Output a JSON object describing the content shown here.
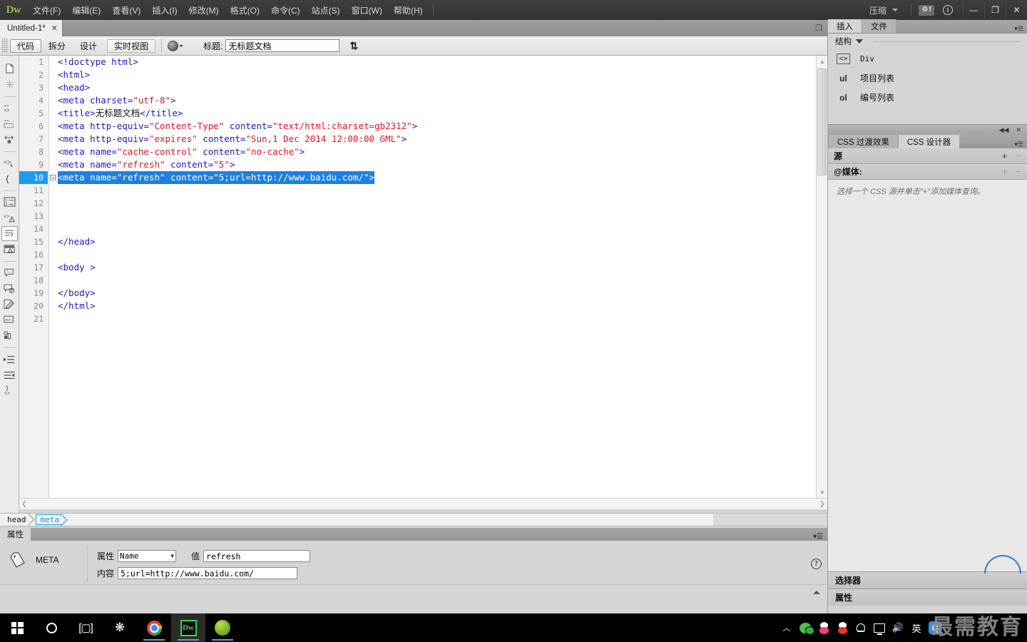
{
  "app": {
    "logo": "Dw",
    "menus": [
      {
        "label": "文件(F)"
      },
      {
        "label": "编辑(E)"
      },
      {
        "label": "查看(V)"
      },
      {
        "label": "插入(I)"
      },
      {
        "label": "修改(M)"
      },
      {
        "label": "格式(O)"
      },
      {
        "label": "命令(C)"
      },
      {
        "label": "站点(S)"
      },
      {
        "label": "窗口(W)"
      },
      {
        "label": "帮助(H)"
      }
    ],
    "workspace_label": "压缩",
    "window_controls": {
      "minimize": "—",
      "restore": "❐",
      "close": "✕"
    }
  },
  "document_tab": {
    "title": "Untitled-1*",
    "close": "✕"
  },
  "view_toolbar": {
    "buttons": [
      {
        "label": "代码",
        "active": true
      },
      {
        "label": "拆分",
        "active": false
      },
      {
        "label": "设计",
        "active": false
      }
    ],
    "live_view_label": "实时视图",
    "title_label": "标题:",
    "title_value": "无标题文档",
    "file_management_icon": "updown-arrows-icon"
  },
  "editor": {
    "lines": [
      {
        "num": "1",
        "indent": 0,
        "selected": false,
        "fold": false,
        "tokens": [
          {
            "t": "&lt;!doctype html&gt;",
            "c": "k-plain"
          }
        ]
      },
      {
        "num": "2",
        "indent": 0,
        "selected": false,
        "fold": false,
        "tokens": [
          {
            "t": "&lt;html&gt;",
            "c": "k-plain"
          }
        ]
      },
      {
        "num": "3",
        "indent": 0,
        "selected": false,
        "fold": false,
        "tokens": [
          {
            "t": "&lt;head&gt;",
            "c": "k-plain"
          }
        ]
      },
      {
        "num": "4",
        "indent": 0,
        "selected": false,
        "fold": false,
        "tokens": [
          {
            "t": "&lt;meta charset=",
            "c": "k-plain"
          },
          {
            "t": "\"utf-8\"",
            "c": "k-str"
          },
          {
            "t": "&gt;",
            "c": "k-plain"
          }
        ]
      },
      {
        "num": "5",
        "indent": 0,
        "selected": false,
        "fold": false,
        "tokens": [
          {
            "t": "&lt;title&gt;",
            "c": "k-plain"
          },
          {
            "t": "无标题文档",
            "c": "k-cjk"
          },
          {
            "t": "&lt;/title&gt;",
            "c": "k-plain"
          }
        ]
      },
      {
        "num": "6",
        "indent": 0,
        "selected": false,
        "fold": false,
        "tokens": [
          {
            "t": "&lt;meta http-equiv=",
            "c": "k-plain"
          },
          {
            "t": "\"Content-Type\"",
            "c": "k-str"
          },
          {
            "t": " content=",
            "c": "k-plain"
          },
          {
            "t": "\"text/html:charset=gb2312\"",
            "c": "k-str"
          },
          {
            "t": "&gt;",
            "c": "k-plain"
          }
        ]
      },
      {
        "num": "7",
        "indent": 0,
        "selected": false,
        "fold": false,
        "tokens": [
          {
            "t": "&lt;meta http-equiv=",
            "c": "k-plain"
          },
          {
            "t": "\"expires\"",
            "c": "k-str"
          },
          {
            "t": " content=",
            "c": "k-plain"
          },
          {
            "t": "\"Sun,1 Dec 2014 12:00:00 GML\"",
            "c": "k-str"
          },
          {
            "t": "&gt;",
            "c": "k-plain"
          }
        ]
      },
      {
        "num": "8",
        "indent": 0,
        "selected": false,
        "fold": false,
        "tokens": [
          {
            "t": "&lt;meta name=",
            "c": "k-plain"
          },
          {
            "t": "\"cache-control\"",
            "c": "k-str"
          },
          {
            "t": " content=",
            "c": "k-plain"
          },
          {
            "t": "\"no-cache\"",
            "c": "k-str"
          },
          {
            "t": "&gt;",
            "c": "k-plain"
          }
        ]
      },
      {
        "num": "9",
        "indent": 0,
        "selected": false,
        "fold": false,
        "tokens": [
          {
            "t": "&lt;meta name=",
            "c": "k-plain"
          },
          {
            "t": "\"refresh\"",
            "c": "k-str"
          },
          {
            "t": " content=",
            "c": "k-plain"
          },
          {
            "t": "\"5\"",
            "c": "k-str"
          },
          {
            "t": "&gt;",
            "c": "k-plain"
          }
        ]
      },
      {
        "num": "10",
        "indent": 0,
        "selected": true,
        "fold": true,
        "tokens": [
          {
            "t": "&lt;meta name=\"refresh\" content=\"5;url=http://www.baidu.com/\"&gt;",
            "c": ""
          }
        ]
      },
      {
        "num": "11",
        "indent": 0,
        "selected": false,
        "fold": false,
        "tokens": []
      },
      {
        "num": "12",
        "indent": 0,
        "selected": false,
        "fold": false,
        "tokens": []
      },
      {
        "num": "13",
        "indent": 0,
        "selected": false,
        "fold": false,
        "tokens": []
      },
      {
        "num": "14",
        "indent": 0,
        "selected": false,
        "fold": false,
        "tokens": []
      },
      {
        "num": "15",
        "indent": 0,
        "selected": false,
        "fold": false,
        "tokens": [
          {
            "t": "&lt;/head&gt;",
            "c": "k-plain"
          }
        ]
      },
      {
        "num": "16",
        "indent": 0,
        "selected": false,
        "fold": false,
        "tokens": []
      },
      {
        "num": "17",
        "indent": 0,
        "selected": false,
        "fold": false,
        "tokens": [
          {
            "t": "&lt;body &gt;",
            "c": "k-plain"
          }
        ]
      },
      {
        "num": "18",
        "indent": 0,
        "selected": false,
        "fold": false,
        "tokens": []
      },
      {
        "num": "19",
        "indent": 0,
        "selected": false,
        "fold": false,
        "tokens": [
          {
            "t": "&lt;/body&gt;",
            "c": "k-plain"
          }
        ]
      },
      {
        "num": "20",
        "indent": 0,
        "selected": false,
        "fold": false,
        "tokens": [
          {
            "t": "&lt;/html&gt;",
            "c": "k-plain"
          }
        ]
      },
      {
        "num": "21",
        "indent": 0,
        "selected": false,
        "fold": false,
        "tokens": []
      }
    ],
    "selection_bg": "#1e7fe0",
    "tag_color": "#1a1ac0",
    "string_color": "#e2152a"
  },
  "tag_selector": {
    "chips": [
      {
        "label": "head",
        "active": false
      },
      {
        "label": "meta",
        "active": true
      }
    ]
  },
  "properties": {
    "tab_label": "属性",
    "element_type": "META",
    "attribute_label": "属性",
    "attribute_value": "Name",
    "value_label": "值",
    "value_value": "refresh",
    "content_label": "内容",
    "content_value": "5;url=http://www.baidu.com/",
    "help_icon": "question-mark-icon"
  },
  "dock": {
    "tabs": [
      {
        "label": "插入",
        "active": true
      },
      {
        "label": "文件",
        "active": false
      }
    ],
    "insert_panel": {
      "category": "结构",
      "items": [
        {
          "icon": "code-brackets-icon",
          "icon_text": "<>",
          "label": "Div",
          "mono": true
        },
        {
          "icon": "ul-icon",
          "icon_text": "ul",
          "label": "项目列表",
          "mono": false
        },
        {
          "icon": "ol-icon",
          "icon_text": "ol",
          "label": "编号列表",
          "mono": false
        }
      ]
    },
    "css_tabs": [
      {
        "label": "CSS 过渡效果",
        "active": false
      },
      {
        "label": "CSS 设计器",
        "active": true
      }
    ],
    "css_designer": {
      "sources_label": "源",
      "media_label": "@媒体:",
      "hint": "选择一个 CSS 源并单击\"+\"添加媒体查询。",
      "selector_label": "选择器",
      "properties_label": "属性"
    }
  },
  "taskbar": {
    "items": [
      {
        "name": "start-button",
        "icon": "windows-logo-icon"
      },
      {
        "name": "cortana-search",
        "icon": "circle-icon"
      },
      {
        "name": "task-view",
        "icon": "task-view-icon"
      },
      {
        "name": "fan-app",
        "icon": "fan-icon"
      },
      {
        "name": "chrome",
        "icon": "chrome-icon",
        "running": true
      },
      {
        "name": "dreamweaver",
        "icon": "dw-icon",
        "running": true,
        "active": true
      },
      {
        "name": "green-app",
        "icon": "green-ball-icon",
        "running": true
      }
    ],
    "tray": [
      {
        "name": "show-hidden-icons",
        "glyph": "︿"
      },
      {
        "name": "wechat-icon"
      },
      {
        "name": "qq-pink-icon"
      },
      {
        "name": "qq-red-icon"
      },
      {
        "name": "notification-bell-icon"
      },
      {
        "name": "display-icon"
      },
      {
        "name": "volume-icon"
      },
      {
        "name": "ime-indicator",
        "glyph": "英"
      },
      {
        "name": "qq-browser-icon",
        "glyph": "Q"
      }
    ]
  },
  "watermark": {
    "text": "最需教育"
  }
}
